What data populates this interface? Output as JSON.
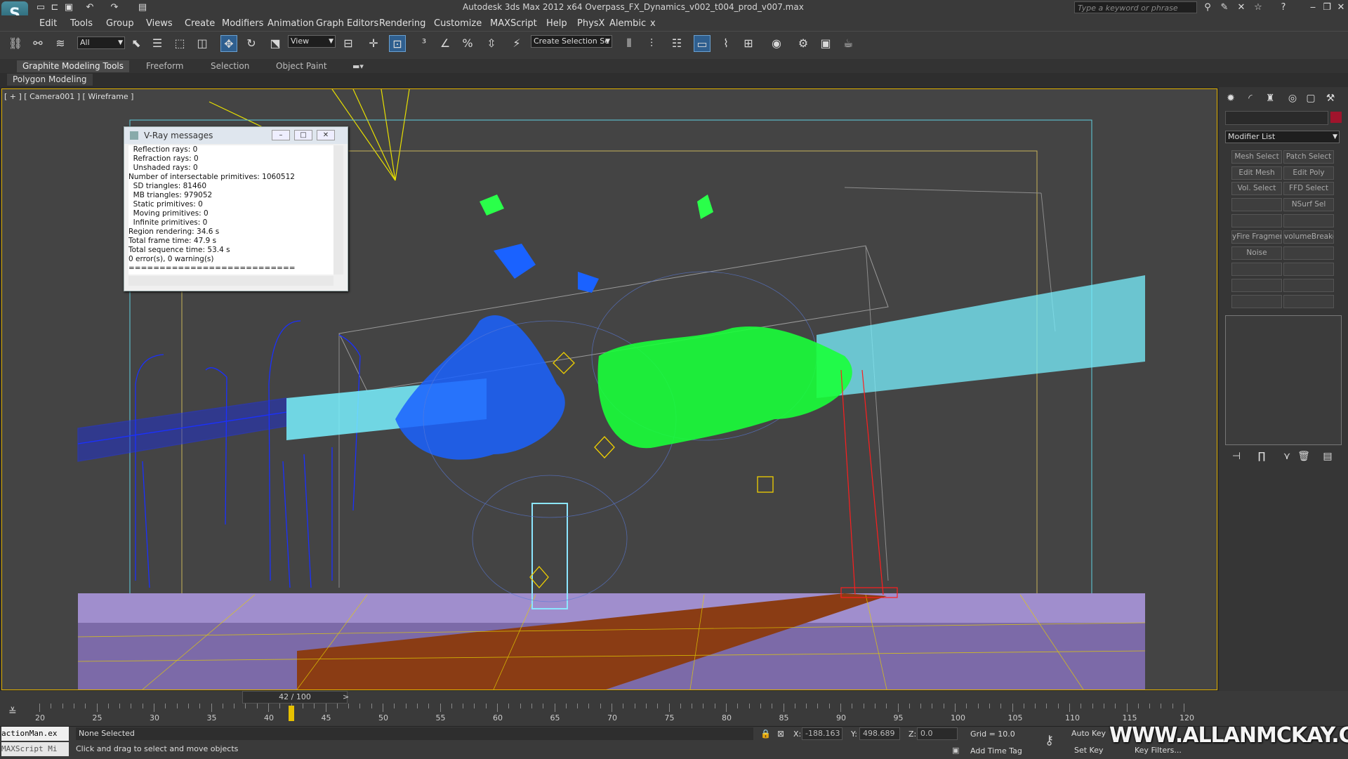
{
  "app": {
    "title": "Autodesk 3ds Max  2012 x64     Overpass_FX_Dynamics_v002_t004_prod_v007.max",
    "logo": "3ds-max-logo",
    "search_placeholder": "Type a keyword or phrase"
  },
  "menu": [
    "Edit",
    "Tools",
    "Group",
    "Views",
    "Create",
    "Modifiers",
    "Animation",
    "Graph Editors",
    "Rendering",
    "Customize",
    "MAXScript",
    "Help",
    "PhysX",
    "Alembic",
    "x"
  ],
  "toolbar": {
    "filter": "All",
    "refcoord": "View",
    "selection_set": "Create Selection Se"
  },
  "ribbon": {
    "tabs": [
      "Graphite Modeling Tools",
      "Freeform",
      "Selection",
      "Object Paint"
    ],
    "panel": "Polygon Modeling"
  },
  "viewport": {
    "label": "[ + ] [ Camera001 ] [ Wireframe ]"
  },
  "vray": {
    "title": "V-Ray messages",
    "lines": [
      "  Reflection rays: 0",
      "  Refraction rays: 0",
      "  Unshaded rays: 0",
      "Number of intersectable primitives: 1060512",
      "  SD triangles: 81460",
      "  MB triangles: 979052",
      "  Static primitives: 0",
      "  Moving primitives: 0",
      "  Infinite primitives: 0",
      "Region rendering: 34.6 s",
      "Total frame time: 47.9 s",
      "Total sequence time: 53.4 s",
      "0 error(s), 0 warning(s)",
      "==========================="
    ]
  },
  "command_panel": {
    "modifier_list": "Modifier List",
    "buttons": [
      [
        "Mesh Select",
        "Patch Select"
      ],
      [
        "Edit Mesh",
        "Edit Poly"
      ],
      [
        "Vol. Select",
        "FFD Select"
      ],
      [
        "",
        "NSurf Sel"
      ],
      [
        "",
        ""
      ],
      [
        "yFire Fragmen",
        "volumeBreaker"
      ],
      [
        "Noise",
        ""
      ],
      [
        "",
        ""
      ],
      [
        "",
        ""
      ],
      [
        "",
        ""
      ]
    ]
  },
  "timeline": {
    "frame": "42 / 100",
    "current": 42,
    "labels": [
      "20",
      "25",
      "30",
      "35",
      "40",
      "45",
      "50",
      "55",
      "60",
      "65",
      "70",
      "75",
      "80",
      "85",
      "90",
      "95",
      "100",
      "105",
      "110",
      "115",
      "120"
    ]
  },
  "status": {
    "maxscript1": "actionMan.ex",
    "maxscript2": "MAXScript Mi",
    "selection": "None Selected",
    "hint": "Click and drag to select and move objects",
    "x": "-188.163",
    "y": "498.689",
    "z": "0.0",
    "grid": "Grid = 10.0",
    "autokey": "Auto Key",
    "setkey": "Set Key",
    "add_time_tag": "Add Time Tag",
    "key_filters": "Key Filters...",
    "watermark": "WWW.ALLANMCKAY.COM"
  }
}
